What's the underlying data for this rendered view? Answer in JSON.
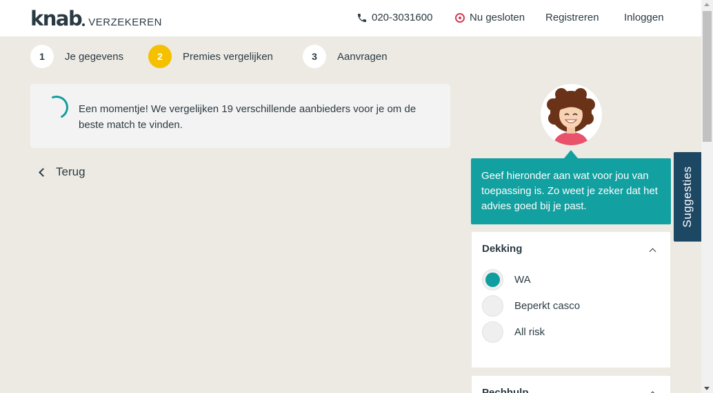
{
  "header": {
    "logo_text": "knab",
    "logo_sub": "VERZEKEREN",
    "phone": "020-3031600",
    "status": "Nu gesloten",
    "register": "Registreren",
    "login": "Inloggen"
  },
  "steps": [
    {
      "number": "1",
      "label": "Je gegevens",
      "active": false
    },
    {
      "number": "2",
      "label": "Premies vergelijken",
      "active": true
    },
    {
      "number": "3",
      "label": "Aanvragen",
      "active": false
    }
  ],
  "loading": {
    "text": "Een momentje! We vergelijken 19 verschillende aanbieders voor je om de beste match te vinden."
  },
  "back": {
    "label": "Terug"
  },
  "assistant": {
    "message": "Geef hieronder aan wat voor jou van toepassing is. Zo weet je zeker dat het advies goed bij je past."
  },
  "filters": {
    "dekking": {
      "title": "Dekking",
      "options": [
        {
          "label": "WA",
          "checked": true
        },
        {
          "label": "Beperkt casco",
          "checked": false
        },
        {
          "label": "All risk",
          "checked": false
        }
      ]
    },
    "pechhulp": {
      "title": "Pechhulp"
    }
  },
  "suggest_tab": {
    "label": "Suggesties"
  },
  "colors": {
    "accent": "#0f9d9f",
    "step_active": "#f5c000",
    "dark_navy": "#1d4863",
    "status_red": "#d63b55",
    "text": "#2b3a42",
    "page_bg": "#edeae4"
  }
}
